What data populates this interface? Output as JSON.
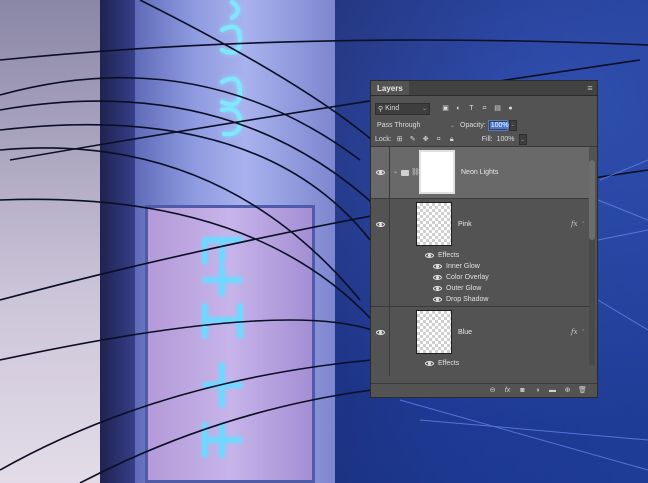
{
  "panel": {
    "tab_label": "Layers",
    "filter": {
      "kind_label": "Kind",
      "icons": [
        "image-filter-icon",
        "adjustment-filter-icon",
        "type-filter-icon",
        "shape-filter-icon",
        "smart-object-filter-icon",
        "filter-toggle-icon"
      ]
    },
    "blend_mode": "Pass Through",
    "opacity_label": "Opacity:",
    "opacity_value": "100%",
    "lock_label": "Lock:",
    "lock_icons": [
      "lock-transparent-icon",
      "lock-paint-icon",
      "lock-position-icon",
      "lock-artboard-icon",
      "lock-all-icon"
    ],
    "fill_label": "Fill:",
    "fill_value": "100%"
  },
  "layers": [
    {
      "name": "Neon Lights",
      "type": "group",
      "visible": true,
      "selected": true
    },
    {
      "name": "Pink",
      "type": "layer",
      "visible": true,
      "fx": "fx",
      "effects_label": "Effects",
      "effects": [
        "Inner Glow",
        "Color Overlay",
        "Outer Glow",
        "Drop Shadow"
      ]
    },
    {
      "name": "Blue",
      "type": "layer",
      "visible": true,
      "fx": "fx",
      "effects_label": "Effects"
    }
  ],
  "footer_icons": [
    "link-layers-icon",
    "add-style-icon",
    "add-mask-icon",
    "adjustment-layer-icon",
    "new-group-icon",
    "new-layer-icon",
    "delete-layer-icon"
  ],
  "colors": {
    "panel_bg": "#535353",
    "selected_row": "#696969",
    "accent": "#4a78d0"
  }
}
